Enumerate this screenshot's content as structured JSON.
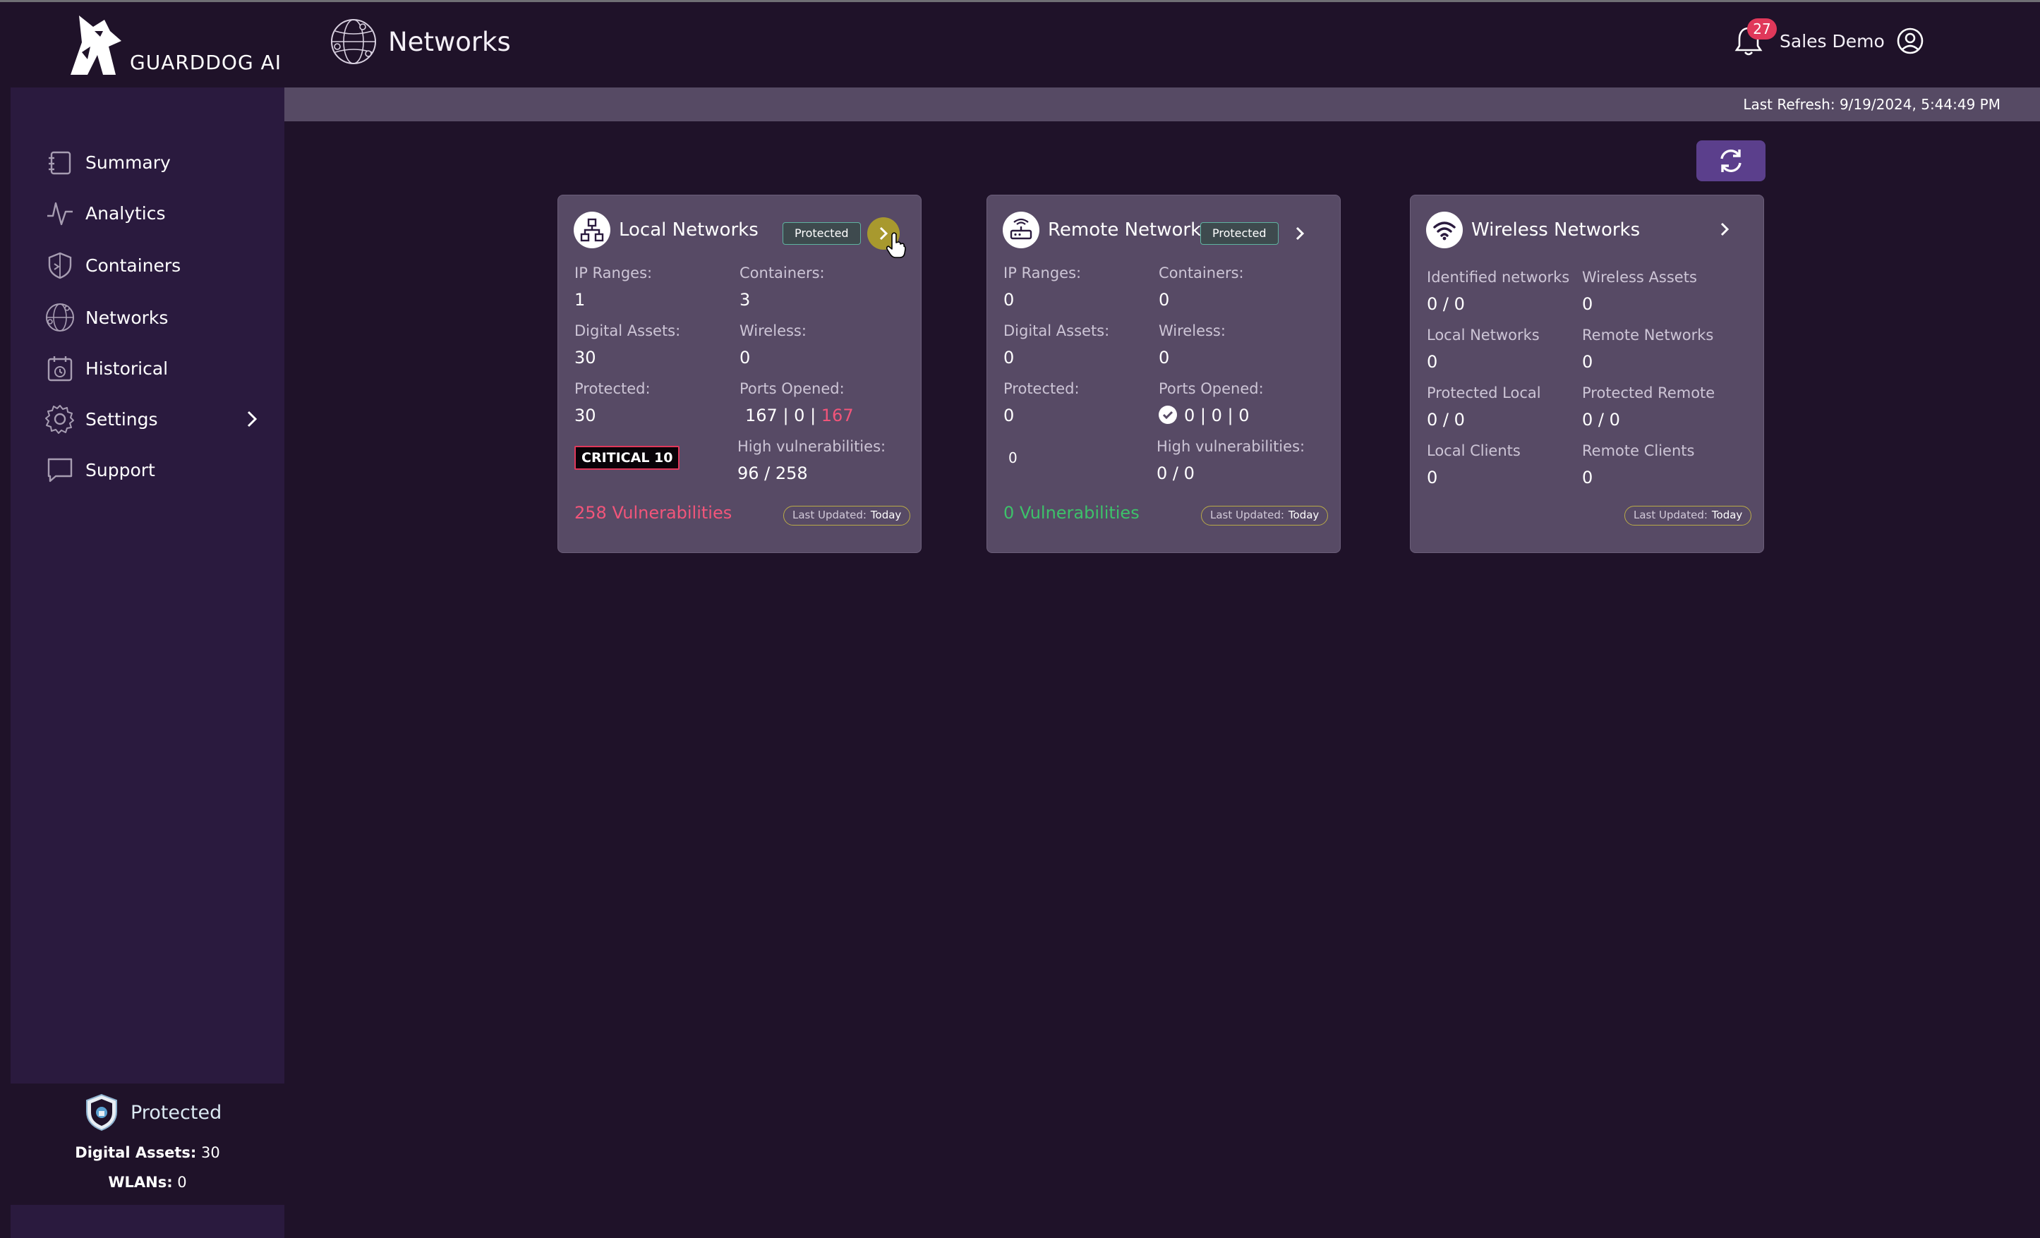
{
  "brand": {
    "name": "GUARDDOG AI"
  },
  "header": {
    "title": "Networks",
    "notifications_count": "27",
    "user_name": "Sales Demo"
  },
  "refresh": {
    "last_refresh": "Last Refresh: 9/19/2024, 5:44:49 PM"
  },
  "sidebar": {
    "items": [
      {
        "label": "Summary",
        "icon": "summary-icon"
      },
      {
        "label": "Analytics",
        "icon": "analytics-icon"
      },
      {
        "label": "Containers",
        "icon": "containers-icon"
      },
      {
        "label": "Networks",
        "icon": "networks-icon"
      },
      {
        "label": "Historical",
        "icon": "historical-icon"
      },
      {
        "label": "Settings",
        "icon": "settings-icon"
      },
      {
        "label": "Support",
        "icon": "support-icon"
      }
    ],
    "footer": {
      "status": "Protected",
      "digital_assets_label": "Digital Assets:",
      "digital_assets_value": "30",
      "wlans_label": "WLANs:",
      "wlans_value": "0"
    }
  },
  "cards": {
    "local": {
      "title": "Local Networks",
      "badge": "Protected",
      "ip_ranges_label": "IP Ranges:",
      "ip_ranges": "1",
      "containers_label": "Containers:",
      "containers": "3",
      "digital_assets_label": "Digital Assets:",
      "digital_assets": "30",
      "wireless_label": "Wireless:",
      "wireless": "0",
      "protected_label": "Protected:",
      "protected": "30",
      "ports_label": "Ports Opened:",
      "ports_a": "167",
      "ports_b": "0",
      "ports_c": "167",
      "critical": "CRITICAL 10",
      "high_vuln_label": "High vulnerabilities:",
      "high_vuln": "96 / 258",
      "vulnerabilities": "258 Vulnerabilities",
      "updated_label": "Last Updated:",
      "updated_value": "Today"
    },
    "remote": {
      "title": "Remote Networks",
      "badge": "Protected",
      "ip_ranges_label": "IP Ranges:",
      "ip_ranges": "0",
      "containers_label": "Containers:",
      "containers": "0",
      "digital_assets_label": "Digital Assets:",
      "digital_assets": "0",
      "wireless_label": "Wireless:",
      "wireless": "0",
      "protected_label": "Protected:",
      "protected": "0",
      "ports_label": "Ports Opened:",
      "ports": "0 | 0 | 0",
      "critical_count": "0",
      "high_vuln_label": "High vulnerabilities:",
      "high_vuln": "0 / 0",
      "vulnerabilities": "0 Vulnerabilities",
      "updated_label": "Last Updated:",
      "updated_value": "Today"
    },
    "wireless": {
      "title": "Wireless Networks",
      "identified_label": "Identified networks",
      "identified": "0 / 0",
      "assets_label": "Wireless Assets",
      "assets": "0",
      "local_label": "Local Networks",
      "local": "0",
      "remote_label": "Remote Networks",
      "remote": "0",
      "prot_local_label": "Protected Local",
      "prot_local": "0 / 0",
      "prot_remote_label": "Protected Remote",
      "prot_remote": "0 / 0",
      "local_clients_label": "Local Clients",
      "local_clients": "0",
      "remote_clients_label": "Remote Clients",
      "remote_clients": "0",
      "updated_label": "Last Updated:",
      "updated_value": "Today"
    }
  },
  "colors": {
    "background": "#1f1229",
    "sidebar": "#2a1a3e",
    "card": "#574a65",
    "accent": "#5b3f8c",
    "danger": "#f2557a",
    "success": "#3dc26a",
    "go_button": "#a8992e"
  }
}
